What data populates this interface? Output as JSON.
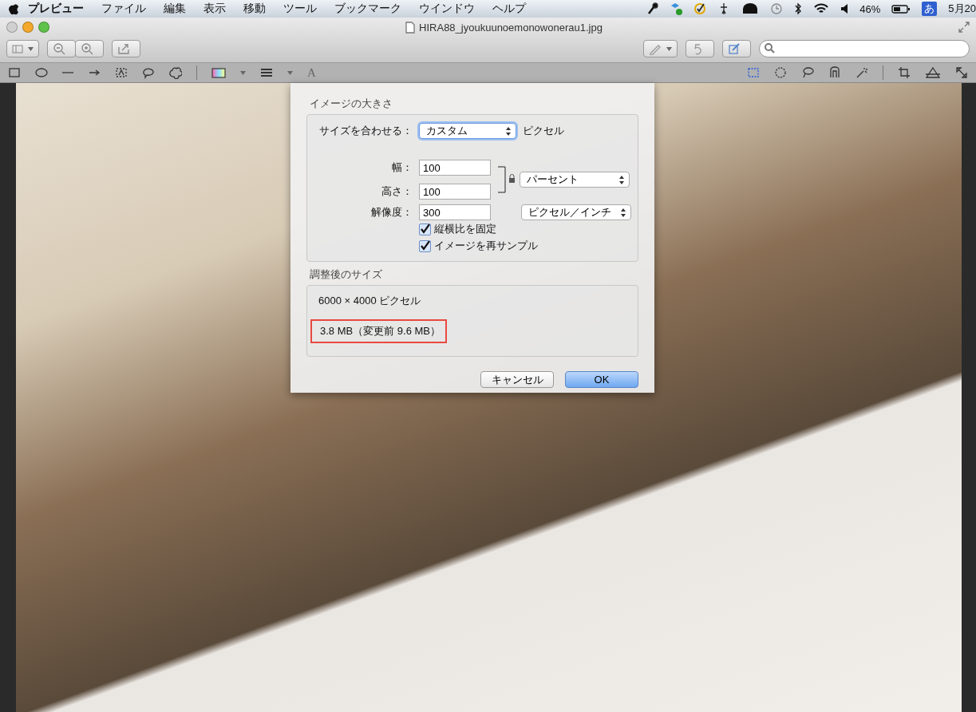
{
  "menu_bar": {
    "app": "プレビュー",
    "items": [
      "ファイル",
      "編集",
      "表示",
      "移動",
      "ツール",
      "ブックマーク",
      "ウインドウ",
      "ヘルプ"
    ],
    "battery": "46%",
    "input_method": "あ",
    "clock": "5月20"
  },
  "window": {
    "title": "HIRA88_jyoukuunoemonowonerau1.jpg",
    "font_tool": "A"
  },
  "dialog": {
    "section_title": "イメージの大きさ",
    "fit_label": "サイズを合わせる：",
    "fit_value": "カスタム",
    "fit_unit": "ピクセル",
    "fields": [
      {
        "label": "幅：",
        "value": "100"
      },
      {
        "label": "高さ：",
        "value": "100"
      },
      {
        "label": "解像度：",
        "value": "300"
      }
    ],
    "size_unit": "パーセント",
    "resolution_unit": "ピクセル／インチ",
    "checkboxes": [
      {
        "label": "縦横比を固定",
        "checked": true
      },
      {
        "label": "イメージを再サンプル",
        "checked": true
      }
    ],
    "result_title": "調整後のサイズ",
    "dimensions": "6000 × 4000 ピクセル",
    "file_size": "3.8 MB（変更前 9.6 MB）",
    "file_size_highlighted": true,
    "buttons": [
      {
        "label": "キャンセル",
        "default": false
      },
      {
        "label": "OK",
        "default": true
      }
    ]
  }
}
